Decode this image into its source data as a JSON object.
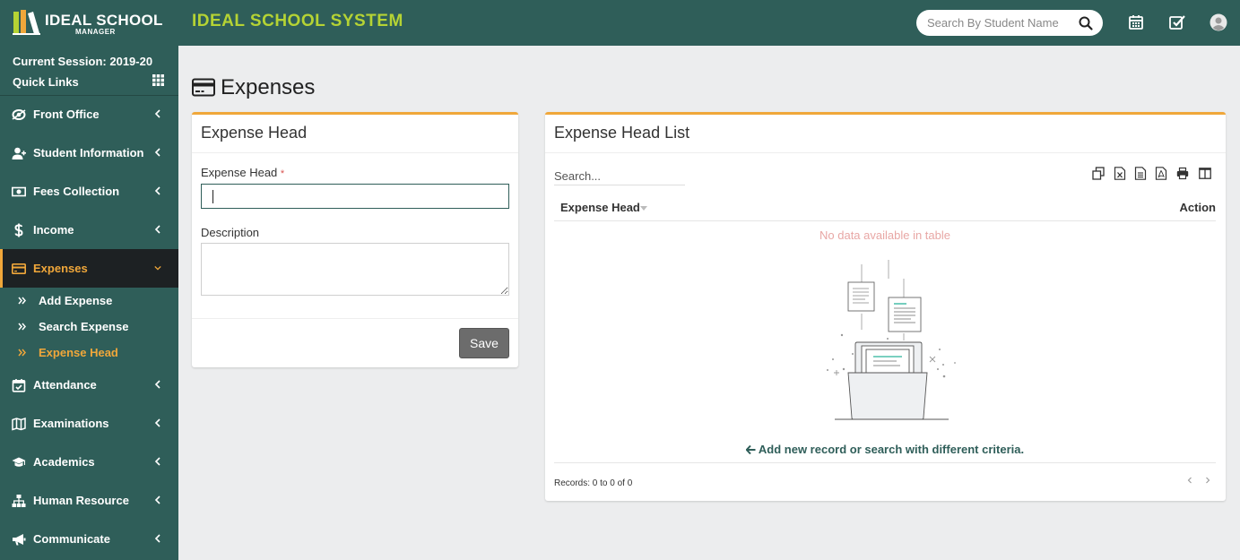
{
  "header": {
    "logo_main": "IDEAL SCHOOL",
    "logo_sub": "MANAGER",
    "app_title": "IDEAL SCHOOL SYSTEM",
    "search_placeholder": "Search By Student Name",
    "icons": [
      "calendar-icon",
      "task-check-icon",
      "user-avatar-icon"
    ]
  },
  "sidebar": {
    "session": "Current Session: 2019-20",
    "quick_links": "Quick Links",
    "items": [
      {
        "label": "Front Office",
        "icon": "front-office-icon"
      },
      {
        "label": "Student Information",
        "icon": "student-icon"
      },
      {
        "label": "Fees Collection",
        "icon": "money-icon"
      },
      {
        "label": "Income",
        "icon": "dollar-icon"
      },
      {
        "label": "Expenses",
        "icon": "credit-card-icon",
        "active": true
      },
      {
        "label": "Attendance",
        "icon": "calendar-check-icon"
      },
      {
        "label": "Examinations",
        "icon": "map-icon"
      },
      {
        "label": "Academics",
        "icon": "graduation-cap-icon"
      },
      {
        "label": "Human Resource",
        "icon": "sitemap-icon"
      },
      {
        "label": "Communicate",
        "icon": "bullhorn-icon"
      }
    ],
    "sub_items": [
      {
        "label": "Add Expense"
      },
      {
        "label": "Search Expense"
      },
      {
        "label": "Expense Head",
        "current": true
      }
    ]
  },
  "page": {
    "heading": "Expenses"
  },
  "form": {
    "title": "Expense Head",
    "expense_head_label": "Expense Head",
    "required_mark": "*",
    "expense_head_value": "",
    "description_label": "Description",
    "description_value": "",
    "save_label": "Save"
  },
  "list": {
    "title": "Expense Head List",
    "search_placeholder": "Search...",
    "toolbar": [
      "copy-icon",
      "excel-icon",
      "csv-icon",
      "pdf-icon",
      "print-icon",
      "columns-icon"
    ],
    "columns": [
      "Expense Head",
      "Action"
    ],
    "empty_message": "No data available in table",
    "hint": "Add new record or search with different criteria.",
    "records": "Records: 0 to 0 of 0"
  },
  "colors": {
    "primary": "#2f5e59",
    "accent": "#f0a73a",
    "title_green": "#b5d334"
  }
}
